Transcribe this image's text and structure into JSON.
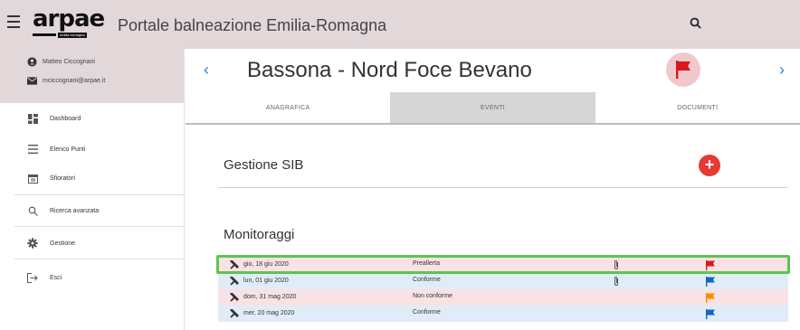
{
  "app": {
    "logo_text": "arpae",
    "logo_subtitle": "emilia-romagna",
    "title": "Portale balneazione Emilia-Romagna"
  },
  "user": {
    "name": "Matteo Ciccognani",
    "email": "mciccognani@arpae.it"
  },
  "sidebar": {
    "items": [
      {
        "label": "Dashboard",
        "icon": "dashboard-icon"
      },
      {
        "label": "Elenco Punti",
        "icon": "list-icon"
      },
      {
        "label": "Sfioratori",
        "icon": "calendar-icon"
      },
      {
        "label": "Ricerca avanzata",
        "icon": "search-icon"
      },
      {
        "label": "Gestione",
        "icon": "gear-icon"
      },
      {
        "label": "Esci",
        "icon": "logout-icon"
      }
    ]
  },
  "header": {
    "place_name": "Bassona - Nord Foce Bevano",
    "prev_icon": "chevron-left-icon",
    "next_icon": "chevron-right-icon",
    "status_flag_color": "#d7191c"
  },
  "tabs": [
    {
      "label": "ANAGRAFICA",
      "active": false
    },
    {
      "label": "EVENTI",
      "active": true
    },
    {
      "label": "DOCUMENTI",
      "active": false
    }
  ],
  "sections": {
    "sib_title": "Gestione SIB",
    "add_label": "+",
    "monitoraggi_title": "Monitoraggi"
  },
  "monitoraggi": [
    {
      "date": "gio, 18 giu 2020",
      "status": "Preallerta",
      "attachment": true,
      "flag_color": "#d7191c"
    },
    {
      "date": "lun, 01 giu 2020",
      "status": "Conforme",
      "attachment": true,
      "flag_color": "#1565c0"
    },
    {
      "date": "dom, 31 mag 2020",
      "status": "Non conforme",
      "attachment": false,
      "flag_color": "#fb8c00"
    },
    {
      "date": "mer, 20 mag 2020",
      "status": "Conforme",
      "attachment": false,
      "flag_color": "#1565c0"
    }
  ],
  "colors": {
    "topbar": "#e2d7d9",
    "accent_blue": "#1e88e5",
    "selected_row_outline": "#5cc454"
  }
}
